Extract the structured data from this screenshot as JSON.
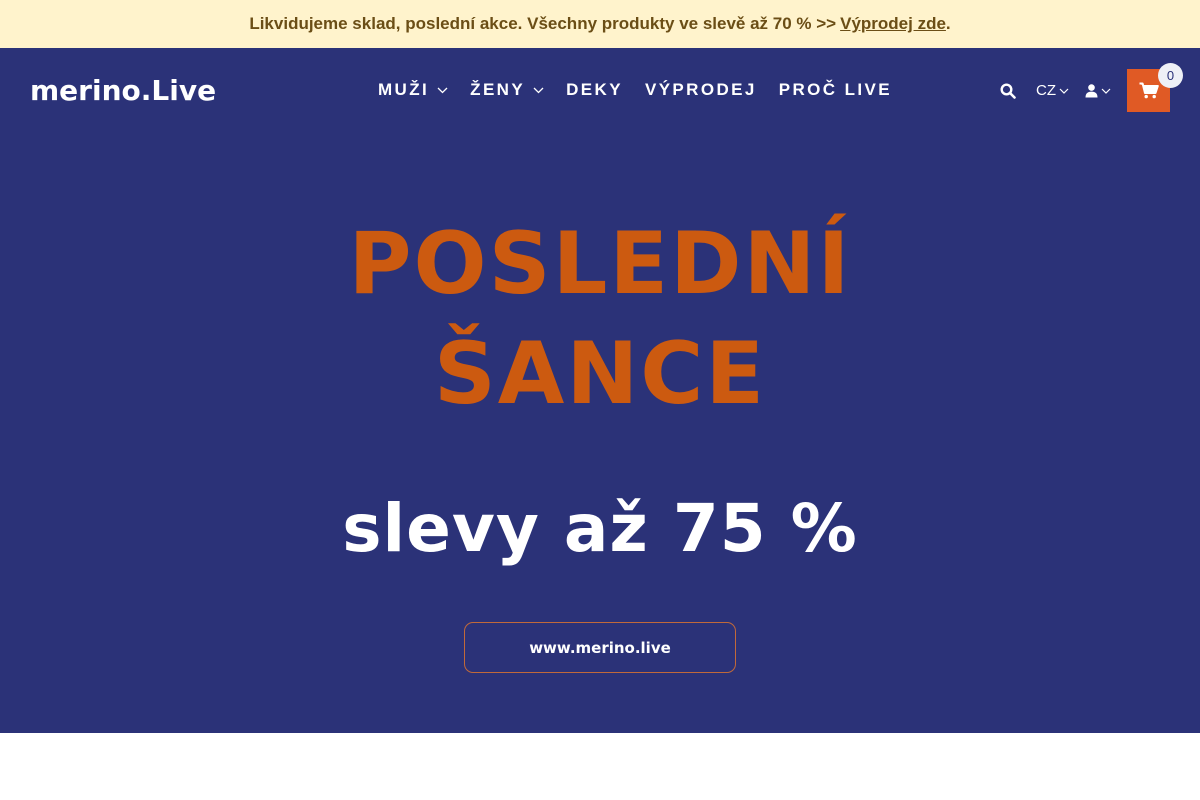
{
  "announcement": {
    "text": "Likvidujeme sklad, poslední akce. Všechny produkty ve slevě až 70 % >>",
    "link": "Výprodej zde",
    "suffix": "."
  },
  "header": {
    "logo_text": "merino.Live",
    "nav": [
      "MUŽI",
      "ŽENY",
      "DEKY",
      "VÝPRODEJ",
      "PROČ LIVE"
    ],
    "language": "CZ",
    "cart_count": "0",
    "icons": {
      "search": "search-icon",
      "user": "user-icon",
      "cart": "cart-icon",
      "dropdown": "chevron-down-icon"
    }
  },
  "hero": {
    "line1": "POSLEDNÍ",
    "line2": "ŠANCE",
    "subtitle": "slevy až 75 %",
    "button": "www.merino.live"
  },
  "colors": {
    "announcement_bg": "#fff3cc",
    "announcement_text": "#6b4e16",
    "brand_navy": "#2b3278",
    "accent_orange": "#e05a25",
    "hero_orange": "#cc5a10"
  }
}
